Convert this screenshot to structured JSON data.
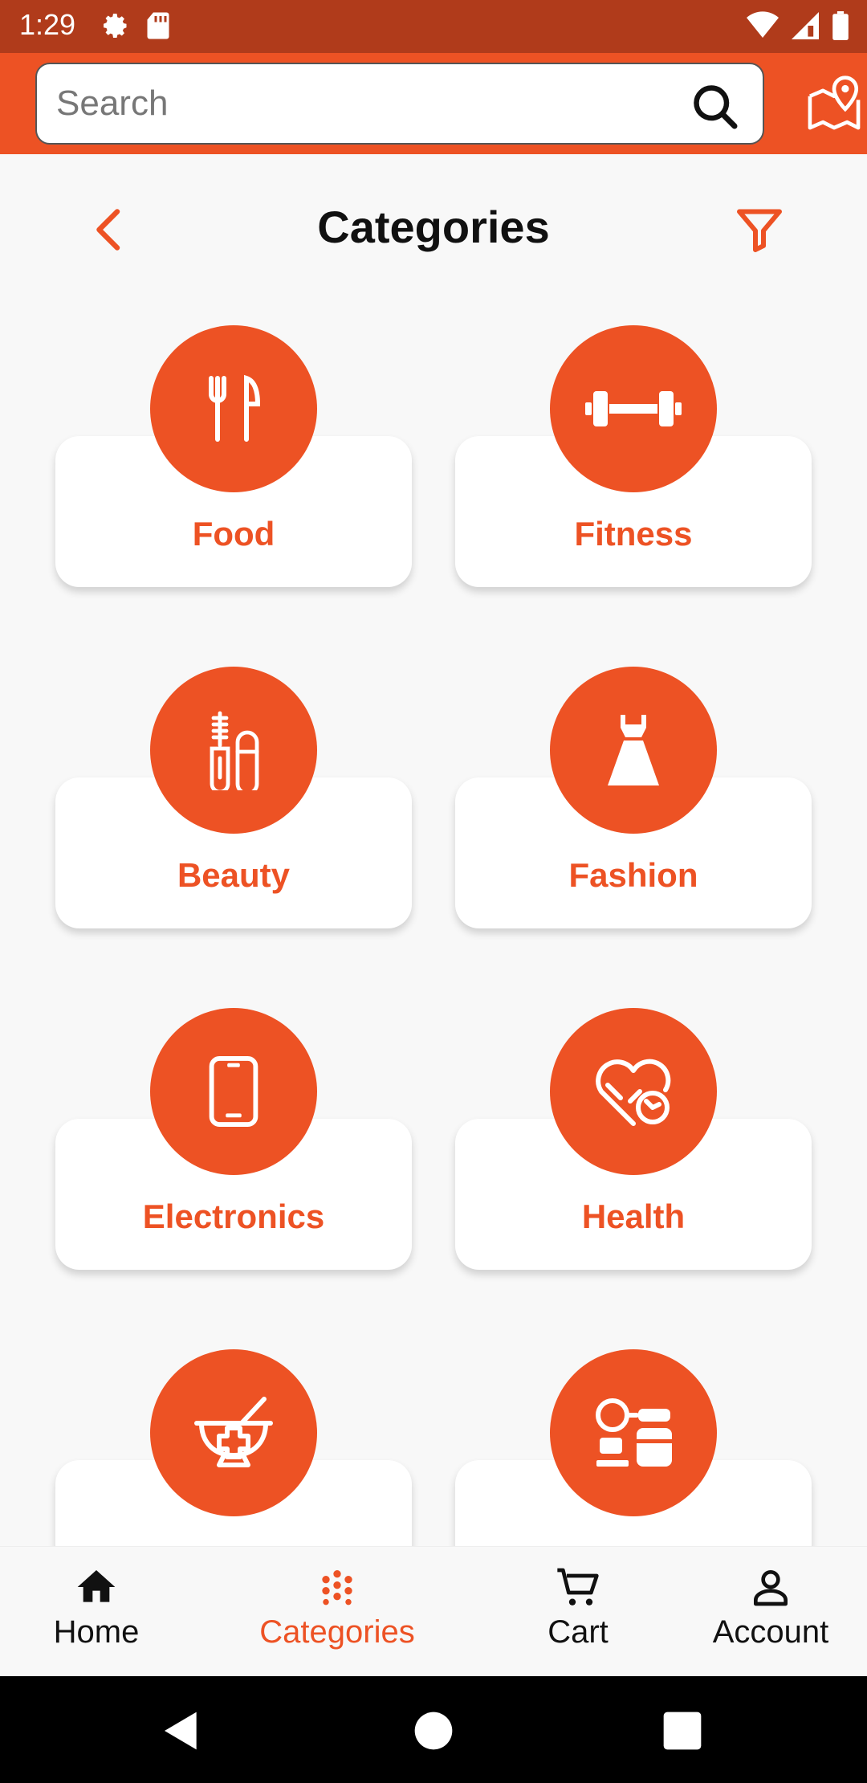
{
  "status_bar": {
    "time": "1:29"
  },
  "search": {
    "placeholder": "Search"
  },
  "header": {
    "title": "Categories"
  },
  "categories": [
    {
      "label": "Food",
      "icon": "fork-knife-icon"
    },
    {
      "label": "Fitness",
      "icon": "dumbbell-icon"
    },
    {
      "label": "Beauty",
      "icon": "mascara-icon"
    },
    {
      "label": "Fashion",
      "icon": "dress-icon"
    },
    {
      "label": "Electronics",
      "icon": "smartphone-icon"
    },
    {
      "label": "Health",
      "icon": "heart-refresh-icon"
    },
    {
      "label": "",
      "icon": "pharmacy-mortar-icon"
    },
    {
      "label": "",
      "icon": "kitchen-appliances-icon"
    }
  ],
  "bottom_nav": {
    "items": [
      {
        "label": "Home",
        "icon": "home-icon",
        "active": false
      },
      {
        "label": "Categories",
        "icon": "categories-dots-icon",
        "active": true
      },
      {
        "label": "Cart",
        "icon": "cart-icon",
        "active": false
      },
      {
        "label": "Account",
        "icon": "account-icon",
        "active": false
      }
    ]
  },
  "colors": {
    "accent": "#ed5224",
    "status_bar": "#b03b1b",
    "background": "#f8f8f8"
  }
}
